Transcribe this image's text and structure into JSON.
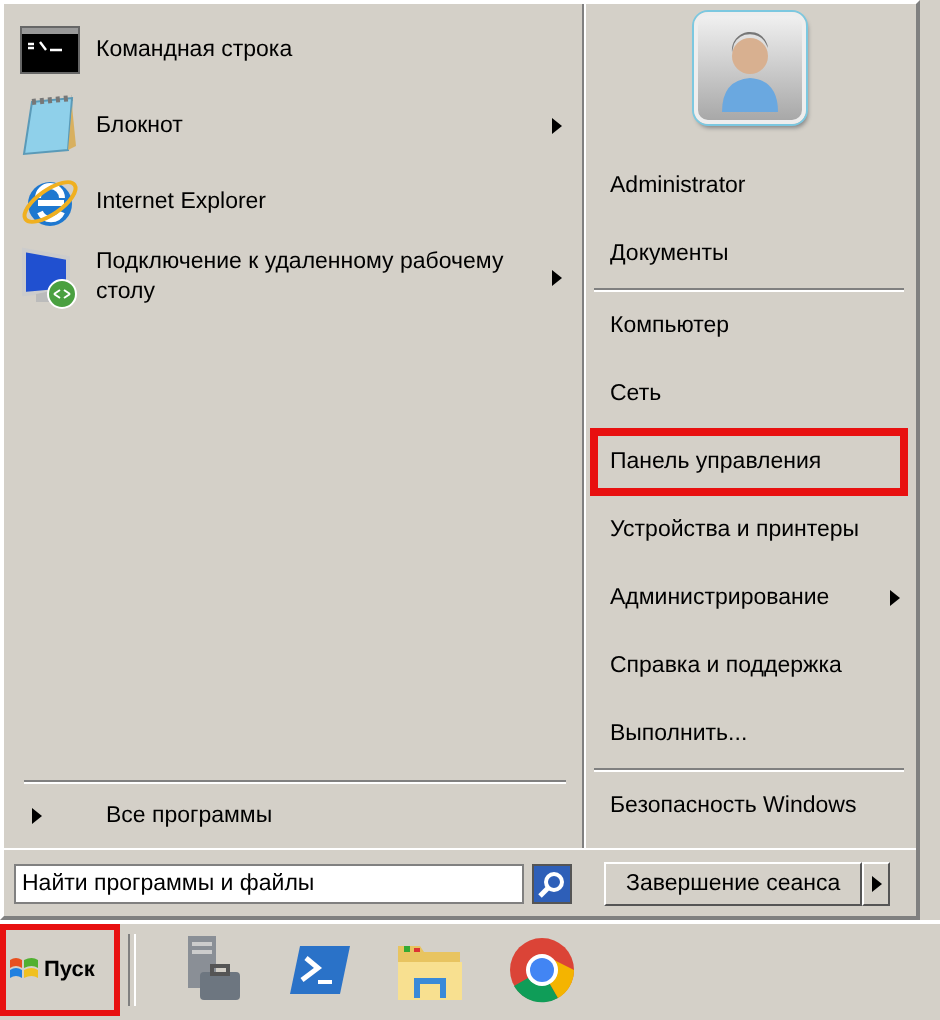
{
  "programs": [
    {
      "label": "Командная строка",
      "kind": "console",
      "has_submenu": false
    },
    {
      "label": "Блокнот",
      "kind": "notepad",
      "has_submenu": true
    },
    {
      "label": "Internet Explorer",
      "kind": "browser",
      "has_submenu": false
    },
    {
      "label": "Подключение к удаленному рабочему столу",
      "kind": "remote",
      "has_submenu": true
    }
  ],
  "all_programs": {
    "label": "Все программы"
  },
  "search": {
    "placeholder": "Найти программы и файлы"
  },
  "right_groups": [
    [
      {
        "label": "Administrator",
        "has_submenu": false,
        "highlighted": false
      },
      {
        "label": "Документы",
        "has_submenu": false,
        "highlighted": false
      }
    ],
    [
      {
        "label": "Компьютер",
        "has_submenu": false,
        "highlighted": false
      },
      {
        "label": "Сеть",
        "has_submenu": false,
        "highlighted": false
      },
      {
        "label": "Панель управления",
        "has_submenu": false,
        "highlighted": true
      },
      {
        "label": "Устройства и принтеры",
        "has_submenu": false,
        "highlighted": false
      },
      {
        "label": "Администрирование",
        "has_submenu": true,
        "highlighted": false
      },
      {
        "label": "Справка и поддержка",
        "has_submenu": false,
        "highlighted": false
      },
      {
        "label": "Выполнить...",
        "has_submenu": false,
        "highlighted": false
      }
    ],
    [
      {
        "label": "Безопасность Windows",
        "has_submenu": false,
        "highlighted": false
      }
    ]
  ],
  "shutdown": {
    "label": "Завершение сеанса"
  },
  "taskbar": {
    "start": {
      "label": "Пуск",
      "highlighted": true
    },
    "apps": [
      {
        "kind": "server"
      },
      {
        "kind": "shell"
      },
      {
        "kind": "folder"
      },
      {
        "kind": "chrome"
      }
    ]
  }
}
